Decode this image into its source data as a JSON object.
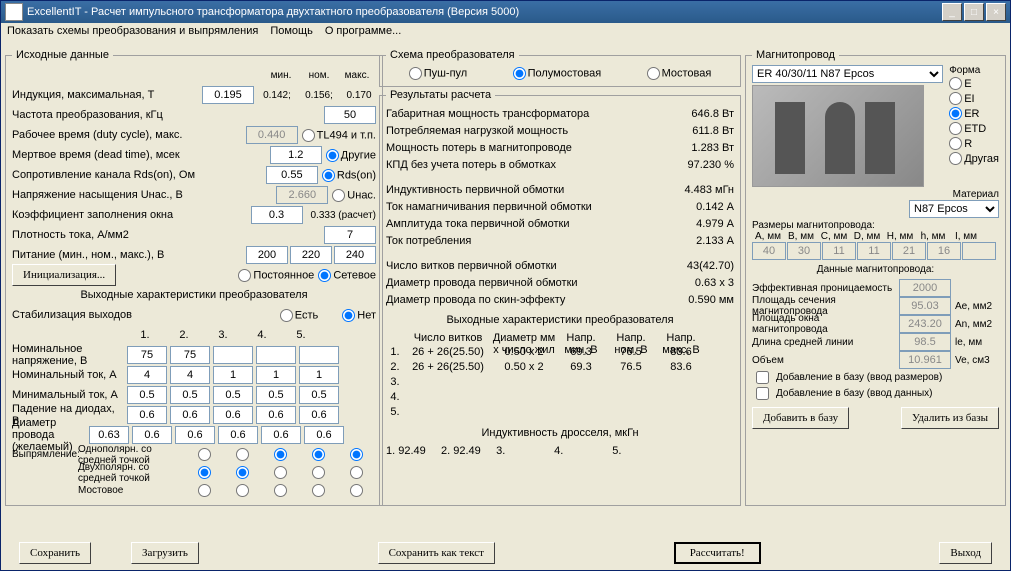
{
  "title": "ExcellentIT - Расчет импульсного трансформатора двухтактного преобразователя (Версия 5000)",
  "menu": {
    "m1": "Показать схемы преобразования и выпрямления",
    "m2": "Помощь",
    "m3": "О программе..."
  },
  "input": {
    "legend": "Исходные данные",
    "hdr": {
      "min": "мин.",
      "nom": "ном.",
      "max": "макс."
    },
    "induction": {
      "lbl": "Индукция, максимальная, Т",
      "val": "0.195",
      "min": "0.142;",
      "nom": "0.156;",
      "max": "0.170"
    },
    "freq": {
      "lbl": "Частота преобразования, кГц",
      "val": "50"
    },
    "duty": {
      "lbl": "Рабочее время (duty cycle), макс.",
      "val": "0.440",
      "r1": "TL494 и т.п."
    },
    "dead": {
      "lbl": "Мертвое время (dead time), мсек",
      "val": "1.2",
      "r2": "Другие"
    },
    "rds": {
      "lbl": "Сопротивление канала Rds(on), Ом",
      "val": "0.55",
      "r": "Rds(on)"
    },
    "usat": {
      "lbl": "Напряжение насыщения Uнас., В",
      "val": "2.660",
      "r": "Uнас."
    },
    "kfill": {
      "lbl": "Коэффициент заполнения окна",
      "val": "0.3",
      "calc": "0.333 (расчет)"
    },
    "jcur": {
      "lbl": "Плотность тока, А/мм2",
      "val": "7"
    },
    "supply": {
      "lbl": "Питание (мин., ном., макс.), В",
      "v1": "200",
      "v2": "220",
      "v3": "240"
    },
    "init_btn": "Инициализация...",
    "psrc": {
      "r1": "Постоянное",
      "r2": "Сетевое"
    },
    "out_legend": "Выходные характеристики преобразователя",
    "stab": {
      "lbl": "Стабилизация выходов",
      "yes": "Есть",
      "no": "Нет"
    },
    "cols": [
      "1.",
      "2.",
      "3.",
      "4.",
      "5."
    ],
    "vnom": {
      "lbl": "Номинальное напряжение, В",
      "v": [
        "75",
        "75",
        "",
        "",
        ""
      ]
    },
    "inom": {
      "lbl": "Номинальный ток, А",
      "v": [
        "4",
        "4",
        "1",
        "1",
        "1"
      ]
    },
    "imin": {
      "lbl": "Минимальный ток, А",
      "v": [
        "0.5",
        "0.5",
        "0.5",
        "0.5",
        "0.5"
      ]
    },
    "vdrop": {
      "lbl": "Падение на диодах, В",
      "v": [
        "0.6",
        "0.6",
        "0.6",
        "0.6",
        "0.6"
      ]
    },
    "wdia": {
      "lbl": "Диаметр провода (желаемый)",
      "own": "0.63",
      "v": [
        "0.6",
        "0.6",
        "0.6",
        "0.6",
        "0.6"
      ]
    },
    "rect": {
      "lbl": "Выпрямление:",
      "r1": "Однополярн. со средней точкой",
      "r2": "Двухполярн. со средней точкой",
      "r3": "Мостовое"
    }
  },
  "scheme": {
    "legend": "Схема преобразователя",
    "r1": "Пуш-пул",
    "r2": "Полумостовая",
    "r3": "Мостовая"
  },
  "results": {
    "legend": "Результаты расчета",
    "p_gab": {
      "l": "Габаритная мощность трансформатора",
      "v": "646.8 Вт"
    },
    "p_load": {
      "l": "Потребляемая нагрузкой мощность",
      "v": "611.8 Вт"
    },
    "p_loss": {
      "l": "Мощность потерь в магнитопроводе",
      "v": "1.283 Вт"
    },
    "eff": {
      "l": "КПД без учета потерь в обмотках",
      "v": "97.230 %"
    },
    "l_prim": {
      "l": "Индуктивность первичной обмотки",
      "v": "4.483 мГн"
    },
    "i_mag": {
      "l": "Ток намагничивания первичной обмотки",
      "v": "0.142 А"
    },
    "i_amp": {
      "l": "Амплитуда тока первичной обмотки",
      "v": "4.979 А"
    },
    "i_cons": {
      "l": "Ток потребления",
      "v": "2.133 А"
    },
    "n_prim": {
      "l": "Число витков первичной обмотки",
      "v": "43(42.70)"
    },
    "d_prim": {
      "l": "Диаметр провода первичной обмотки",
      "v": "0.63 x 3"
    },
    "d_skin": {
      "l": "Диаметр провода по скин-эффекту",
      "v": "0.590 мм"
    },
    "out_hdr": "Выходные характеристики преобразователя",
    "oh": {
      "n": "Число витков",
      "d": "Диаметр мм x число жил",
      "vmin": "Напр. мин, В",
      "vnom": "Напр. ном, В",
      "vmax": "Напр. макс, В"
    },
    "rows": [
      {
        "i": "1.",
        "n": "26 + 26(25.50)",
        "d": "0.50 x 2",
        "vmin": "69.3",
        "vnom": "76.5",
        "vmax": "83.6"
      },
      {
        "i": "2.",
        "n": "26 + 26(25.50)",
        "d": "0.50 x 2",
        "vmin": "69.3",
        "vnom": "76.5",
        "vmax": "83.6"
      },
      {
        "i": "3.",
        "n": "",
        "d": "",
        "vmin": "",
        "vnom": "",
        "vmax": ""
      },
      {
        "i": "4.",
        "n": "",
        "d": "",
        "vmin": "",
        "vnom": "",
        "vmax": ""
      },
      {
        "i": "5.",
        "n": "",
        "d": "",
        "vmin": "",
        "vnom": "",
        "vmax": ""
      }
    ],
    "ind_hdr": "Индуктивность дросселя, мкГн",
    "ind": "1. 92.49     2. 92.49     3.                4.                5."
  },
  "core": {
    "legend": "Магнитопровод",
    "sel": "ER 40/30/11 N87 Epcos",
    "shape_lbl": "Форма",
    "shapes": [
      "E",
      "EI",
      "ER",
      "ETD",
      "R",
      "Другая"
    ],
    "mat_lbl": "Материал",
    "mat": "N87 Epcos",
    "dims_lbl": "Размеры магнитопровода:",
    "dh": [
      "A, мм",
      "B, мм",
      "C, мм",
      "D, мм",
      "H, мм",
      "h, мм",
      "I, мм"
    ],
    "dv": [
      "40",
      "30",
      "11",
      "11",
      "21",
      "16",
      ""
    ],
    "data_lbl": "Данные магнитопровода:",
    "perm": {
      "l": "Эффективная проницаемость",
      "v": "2000",
      "u": ""
    },
    "area": {
      "l": "Площадь сечения магнитопровода",
      "v": "95.03",
      "u": "Ae, мм2"
    },
    "win": {
      "l": "Площадь окна магнитопровода",
      "v": "243.20",
      "u": "An, мм2"
    },
    "len": {
      "l": "Длина средней линии",
      "v": "98.5",
      "u": "le, мм"
    },
    "vol": {
      "l": "Объем",
      "v": "10.961",
      "u": "Ve, см3"
    },
    "cb1": "Добавление в базу (ввод размеров)",
    "cb2": "Добавление в базу (ввод данных)",
    "add_btn": "Добавить в базу",
    "del_btn": "Удалить из базы"
  },
  "buttons": {
    "save": "Сохранить",
    "load": "Загрузить",
    "save_txt": "Сохранить как текст",
    "calc": "Рассчитать!",
    "exit": "Выход"
  }
}
